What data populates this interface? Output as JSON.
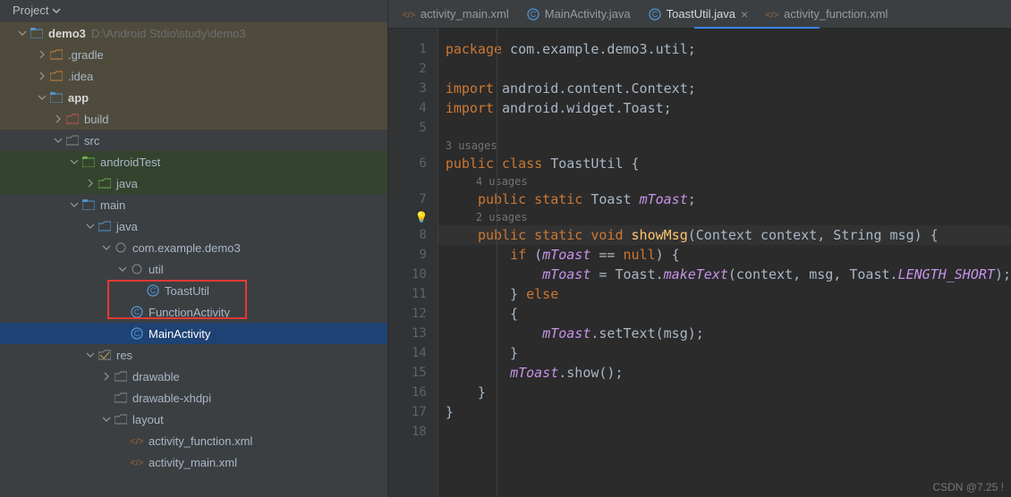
{
  "panel": {
    "title": "Project"
  },
  "tree": {
    "root": {
      "name": "demo3",
      "path": "D:\\Android Stdio\\study\\demo3"
    },
    "gradle": ".gradle",
    "idea": ".idea",
    "app": "app",
    "build": "build",
    "src": "src",
    "androidTest": "androidTest",
    "androidTest_java": "java",
    "main": "main",
    "main_java": "java",
    "pkg": "com.example.demo3",
    "util": "util",
    "toastUtil": "ToastUtil",
    "functionActivity": "FunctionActivity",
    "mainActivity": "MainActivity",
    "res": "res",
    "drawable": "drawable",
    "drawable_xhdpi": "drawable-xhdpi",
    "layout": "layout",
    "activity_function_xml": "activity_function.xml",
    "activity_main_xml": "activity_main.xml"
  },
  "tabs": [
    {
      "name": "activity_main.xml",
      "icon": "xml",
      "active": false
    },
    {
      "name": "MainActivity.java",
      "icon": "class",
      "active": false
    },
    {
      "name": "ToastUtil.java",
      "icon": "class",
      "active": true
    },
    {
      "name": "activity_function.xml",
      "icon": "xml",
      "active": false
    }
  ],
  "hints": {
    "u3": "3 usages",
    "u4": "4 usages",
    "u2": "2 usages"
  },
  "code": {
    "l1": "package com.example.demo3.util;",
    "l2": "",
    "l3": "import android.content.Context;",
    "l4": "import android.widget.Toast;",
    "l5": "",
    "l6": "public class ToastUtil {",
    "l7": "    public static Toast mToast;",
    "l8": "    public static void showMsg(Context context, String msg) {",
    "l9": "        if (mToast == null) {",
    "l10": "            mToast = Toast.makeText(context, msg, Toast.LENGTH_SHORT);",
    "l11": "        } else",
    "l12": "        {",
    "l13": "            mToast.setText(msg);",
    "l14": "        }",
    "l15": "        mToast.show();",
    "l16": "    }",
    "l17": "}",
    "l18": ""
  },
  "watermark": "CSDN @7.25 !"
}
